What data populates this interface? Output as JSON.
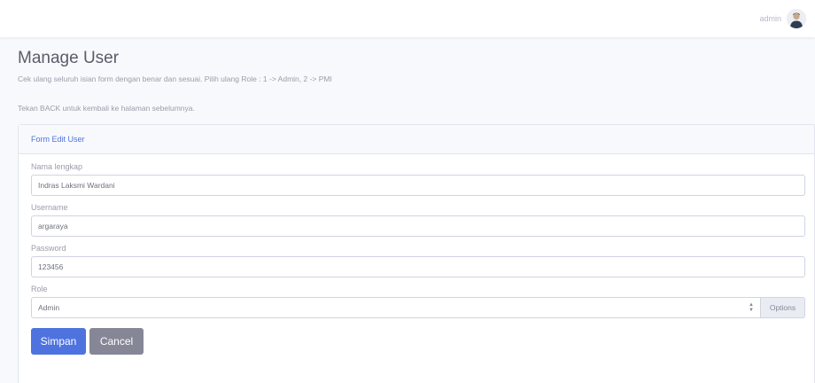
{
  "topbar": {
    "user_name": "admin"
  },
  "page": {
    "title": "Manage User",
    "description_1": "Cek ulang seluruh isian form dengan benar dan sesuai. Pilih ulang Role : 1 -> Admin, 2 -> PMI",
    "description_2": "Tekan BACK untuk kembali ke halaman sebelumnya."
  },
  "form": {
    "header_title": "Form Edit User",
    "fields": {
      "nama": {
        "label": "Nama lengkap",
        "value": "Indras Laksmi Wardani"
      },
      "username": {
        "label": "Username",
        "value": "argaraya"
      },
      "password": {
        "label": "Password",
        "value": "123456"
      },
      "role": {
        "label": "Role",
        "selected": "Admin",
        "addon": "Options"
      }
    },
    "buttons": {
      "save": "Simpan",
      "cancel": "Cancel"
    }
  },
  "colors": {
    "primary": "#4e73df",
    "secondary": "#858796",
    "background": "#f8f9fc"
  },
  "icons": {
    "avatar": "user-avatar-icon",
    "select_arrow": "select-arrows-icon"
  }
}
